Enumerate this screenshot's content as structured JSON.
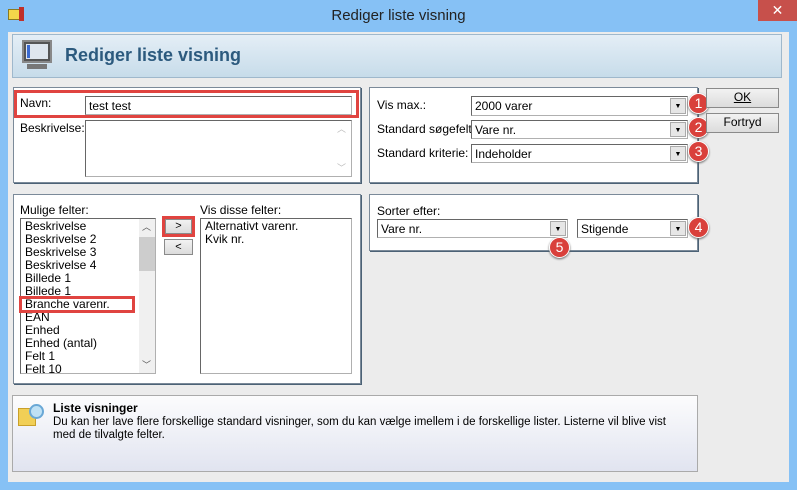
{
  "window": {
    "title": "Rediger liste visning",
    "close": "✕"
  },
  "header": {
    "title": "Rediger liste visning"
  },
  "form": {
    "name_label": "Navn:",
    "name_value": "test test",
    "description_label": "Beskrivelse:",
    "description_value": ""
  },
  "settings": {
    "vis_max_label": "Vis max.:",
    "vis_max_value": "2000 varer",
    "search_field_label": "Standard søgefelt:",
    "search_field_value": "Vare nr.",
    "criteria_label": "Standard kriterie:",
    "criteria_value": "Indeholder"
  },
  "buttons": {
    "ok": "OK",
    "cancel": "Fortryd",
    "add": ">",
    "remove": "<"
  },
  "sort": {
    "label": "Sorter efter:",
    "field_value": "Vare nr.",
    "order_value": "Stigende"
  },
  "fields": {
    "available_label": "Mulige felter:",
    "available": [
      "Beskrivelse",
      "Beskrivelse 2",
      "Beskrivelse 3",
      "Beskrivelse 4",
      "Billede 1",
      "Billede 1",
      "Branche varenr.",
      "EAN",
      "Enhed",
      "Enhed (antal)",
      "Felt 1",
      "Felt 10"
    ],
    "selected_label": "Vis disse felter:",
    "selected": [
      "Alternativt varenr.",
      "Kvik nr."
    ]
  },
  "badges": [
    "1",
    "2",
    "3",
    "4",
    "5"
  ],
  "info": {
    "title": "Liste visninger",
    "text": "Du kan her lave flere forskellige standard visninger, som du kan vælge imellem i de forskellige lister. Listerne vil blive vist med de tilvalgte felter."
  }
}
